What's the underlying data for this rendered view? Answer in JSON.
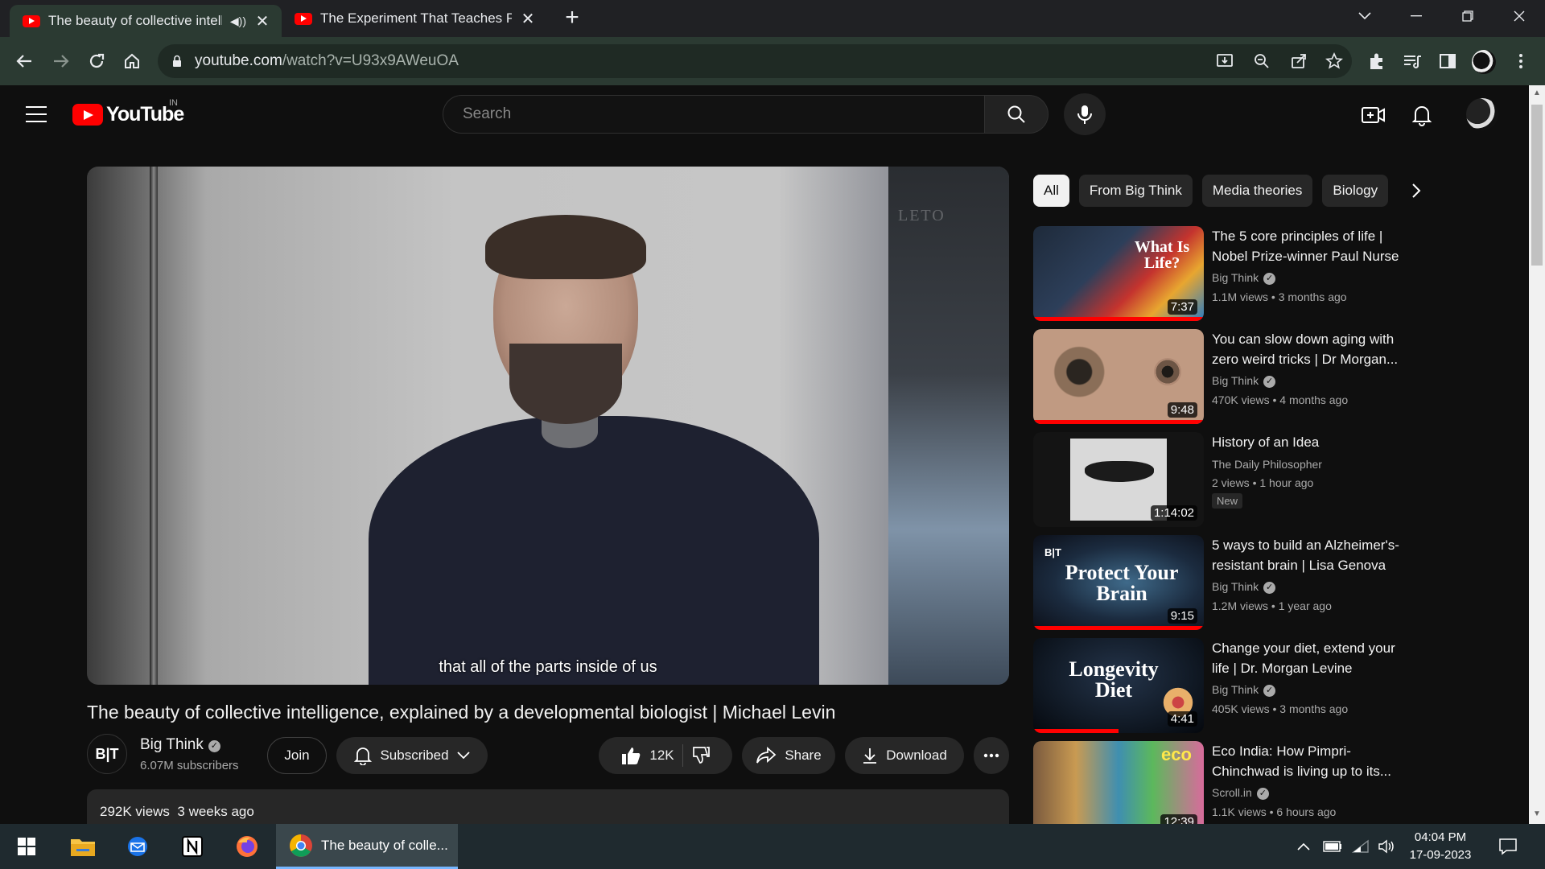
{
  "browser": {
    "tabs": [
      {
        "title": "The beauty of collective intelligence",
        "active": true
      },
      {
        "title": "The Experiment That Teaches People",
        "active": false
      }
    ],
    "url_host": "youtube.com",
    "url_path": "/watch?v=U93x9AWeuOA"
  },
  "youtube": {
    "logo_text": "YouTube",
    "region": "IN",
    "search_placeholder": "Search"
  },
  "player": {
    "caption": "that all of the parts inside of us",
    "watermark": "LETO"
  },
  "video": {
    "title": "The beauty of collective intelligence, explained by a developmental biologist | Michael Levin",
    "channel_avatar_text": "B|T",
    "channel_name": "Big Think",
    "subscribers": "6.07M subscribers",
    "join_label": "Join",
    "subscribed_label": "Subscribed",
    "like_count": "12K",
    "share_label": "Share",
    "download_label": "Download",
    "views": "292K views",
    "age": "3 weeks ago"
  },
  "chips": [
    "All",
    "From Big Think",
    "Media theories",
    "Biology"
  ],
  "recommendations": [
    {
      "title": "The 5 core principles of life | Nobel Prize-winner Paul Nurse",
      "channel": "Big Think",
      "verified": true,
      "views": "1.1M views",
      "age": "3 months ago",
      "duration": "7:37",
      "progress": 1.0,
      "thumb_text": "What Is Life?",
      "badge": ""
    },
    {
      "title": "You can slow down aging with zero weird tricks | Dr Morgan...",
      "channel": "Big Think",
      "verified": true,
      "views": "470K views",
      "age": "4 months ago",
      "duration": "9:48",
      "progress": 1.0,
      "thumb_text": "",
      "badge": ""
    },
    {
      "title": "History of an Idea",
      "channel": "The Daily Philosopher",
      "verified": false,
      "views": "2 views",
      "age": "1 hour ago",
      "duration": "1:14:02",
      "progress": 0,
      "thumb_text": "",
      "badge": "New"
    },
    {
      "title": "5 ways to build an Alzheimer's-resistant brain | Lisa Genova",
      "channel": "Big Think",
      "verified": true,
      "views": "1.2M views",
      "age": "1 year ago",
      "duration": "9:15",
      "progress": 1.0,
      "thumb_text": "Protect Your Brain",
      "badge": ""
    },
    {
      "title": "Change your diet, extend your life | Dr. Morgan Levine",
      "channel": "Big Think",
      "verified": true,
      "views": "405K views",
      "age": "3 months ago",
      "duration": "4:41",
      "progress": 0.5,
      "thumb_text": "Longevity Diet",
      "badge": ""
    },
    {
      "title": "Eco India: How Pimpri-Chinchwad is living up to its...",
      "channel": "Scroll.in",
      "verified": true,
      "views": "1.1K views",
      "age": "6 hours ago",
      "duration": "12:39",
      "progress": 0,
      "thumb_text": "eco",
      "badge": ""
    }
  ],
  "taskbar": {
    "chrome_window_title": "The beauty of colle...",
    "time": "04:04 PM",
    "date": "17-09-2023"
  },
  "colors": {
    "brand_red": "#ff0000",
    "toolbar_green": "#2b3a32"
  }
}
